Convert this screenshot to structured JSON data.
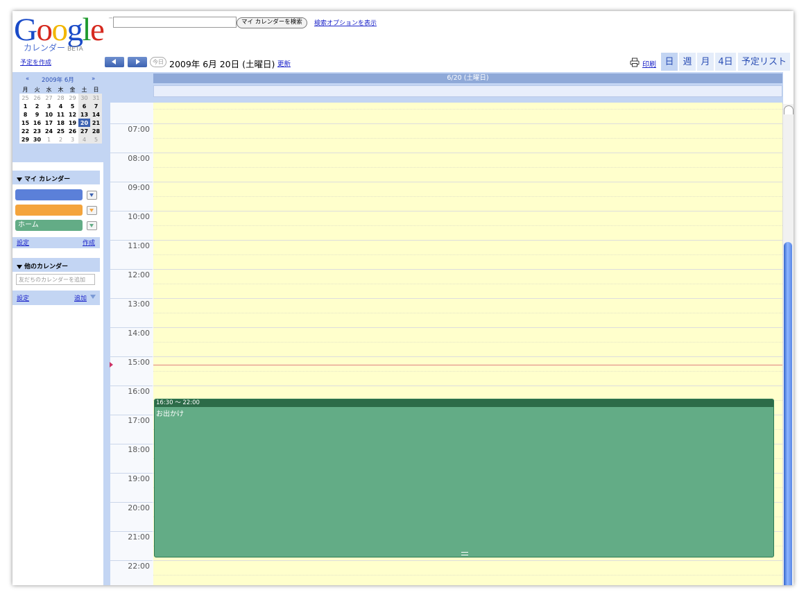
{
  "header": {
    "logo_letters": [
      "G",
      "o",
      "o",
      "g",
      "l",
      "e"
    ],
    "logo_colors": [
      "#1a4bc8",
      "#d62a1f",
      "#f2b600",
      "#1a4bc8",
      "#1f9a2e",
      "#d62a1f"
    ],
    "logo_tm": "™",
    "logo_sub": "カレンダー",
    "logo_beta": "BETA",
    "search_value": "",
    "search_button": "マイ カレンダーを検索",
    "search_options": "検索オプションを表示"
  },
  "sidebar": {
    "create_event": "予定を作成",
    "mini_cal": {
      "prev": "«",
      "title": "2009年 6月",
      "next": "»",
      "weekdays": [
        "月",
        "火",
        "水",
        "木",
        "金",
        "土",
        "日"
      ],
      "weeks": [
        [
          "25",
          "26",
          "27",
          "28",
          "29",
          "30",
          "31"
        ],
        [
          "1",
          "2",
          "3",
          "4",
          "5",
          "6",
          "7"
        ],
        [
          "8",
          "9",
          "10",
          "11",
          "12",
          "13",
          "14"
        ],
        [
          "15",
          "16",
          "17",
          "18",
          "19",
          "20",
          "21"
        ],
        [
          "22",
          "23",
          "24",
          "25",
          "26",
          "27",
          "28"
        ],
        [
          "29",
          "30",
          "1",
          "2",
          "3",
          "4",
          "5"
        ]
      ],
      "selected": "20"
    },
    "my_calendars": {
      "title": "マイ カレンダー",
      "items": [
        {
          "label": "",
          "color": "#5b80d9"
        },
        {
          "label": "",
          "color": "#f4a43c"
        },
        {
          "label": "ホーム",
          "color": "#63ac86"
        }
      ],
      "settings": "設定",
      "create": "作成"
    },
    "other_calendars": {
      "title": "他のカレンダー",
      "add_placeholder": "友だちのカレンダーを追加",
      "settings": "設定",
      "add": "追加"
    }
  },
  "toolbar": {
    "today": "今日",
    "date": "2009年 6月 20日 (土曜日)",
    "refresh": "更新",
    "print": "印刷",
    "tabs": [
      "日",
      "週",
      "月",
      "4日",
      "予定リスト"
    ],
    "active_tab": "日"
  },
  "day_view": {
    "column_header": "6/20 (土曜日)",
    "hours": [
      "07:00",
      "08:00",
      "09:00",
      "10:00",
      "11:00",
      "12:00",
      "13:00",
      "14:00",
      "15:00",
      "16:00",
      "17:00",
      "18:00",
      "19:00",
      "20:00",
      "21:00",
      "22:00"
    ],
    "event": {
      "time": "16:30 ～ 22:00",
      "title": "お出かけ",
      "color": "#63ac86"
    }
  }
}
